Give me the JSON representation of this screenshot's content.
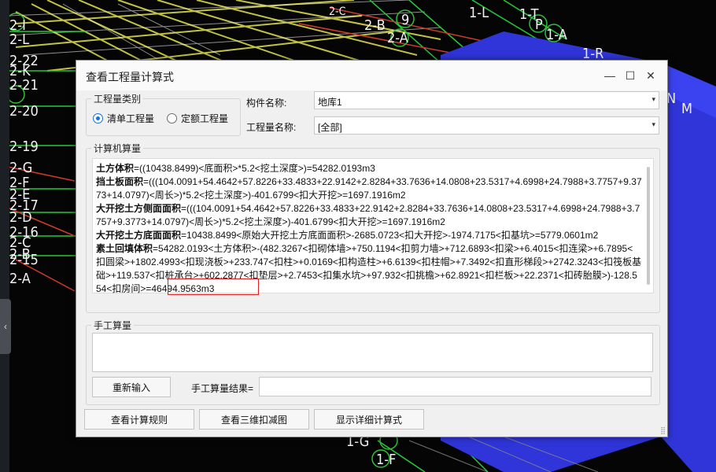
{
  "cad_labels": [
    "2-L",
    "2-I",
    "2-22",
    "2-K",
    "2-21",
    "2-20",
    "2-19",
    "2-G",
    "2-F",
    "2-E",
    "2-17",
    "2-D",
    "2-16",
    "2-C",
    "2-B",
    "2-15",
    "2-A",
    "2-C",
    "9",
    "2-B",
    "2-A",
    "1-L",
    "1-T",
    "P",
    "1-A",
    "1-R",
    "N",
    "M",
    "1-G",
    "1-F"
  ],
  "dialog": {
    "title": "查看工程量计算式",
    "category_group_label": "工程量类别",
    "radio_list": "清单工程量",
    "radio_quota": "定额工程量",
    "component_label": "构件名称:",
    "component_value": "地库1",
    "quantity_label": "工程量名称:",
    "quantity_value": "[全部]",
    "computer_group_label": "计算机算量",
    "calc_lines": [
      {
        "name": "土方体积",
        "text": "=((10438.8499)<底面积>*5.2<挖土深度>)=54282.0193m3"
      },
      {
        "name": "挡土板面积",
        "text": "=(((104.0091+54.4642+57.8226+33.4833+22.9142+2.8284+33.7636+14.0808+23.5317+4.6998+24.7988+3.7757+9.3773+14.0797)<周长>)*5.2<挖土深度>)-401.6799<扣大开挖>=1697.1916m2"
      },
      {
        "name": "大开挖土方侧面面积",
        "text": "=(((104.0091+54.4642+57.8226+33.4833+22.9142+2.8284+33.7636+14.0808+23.5317+4.6998+24.7988+3.7757+9.3773+14.0797)<周长>)*5.2<挖土深度>)-401.6799<扣大开挖>=1697.1916m2"
      },
      {
        "name": "大开挖土方底面面积",
        "text": "=10438.8499<原始大开挖土方底面面积>-2685.0723<扣大开挖>-1974.7175<扣基坑>=5779.0601m2"
      }
    ],
    "calc_last_name": "素土回填体积",
    "calc_last_pre": "=54282.0193<土方体积>-(482.3267<扣砌体墙>+750.1194<扣剪力墙>+712.6893<扣梁>+6.4015<扣连梁>+6.7895<扣圆梁>+1802.4993<扣现浇板>+233.747<扣柱>+0.0169<扣构造柱>+6.6139<扣柱帽>+7.3492<扣直形梯段>+2742.3243<扣筏板基础>+119.537<扣桩承台>+602.2877<扣垫层>+2.7453<扣集水坑>+97.932<扣挑檐>+62.8921<扣栏板>+22.2371<扣砖胎膜>",
    "calc_last_highlight": ")-128.554<扣房间>",
    "calc_last_post": "=46494.9563m3",
    "manual_group_label": "手工算量",
    "reinput_button": "重新输入",
    "manual_result_label": "手工算量结果=",
    "view_rules_button": "查看计算规则",
    "view_3d_button": "查看三维扣减图",
    "show_detail_button": "显示详细计算式"
  }
}
